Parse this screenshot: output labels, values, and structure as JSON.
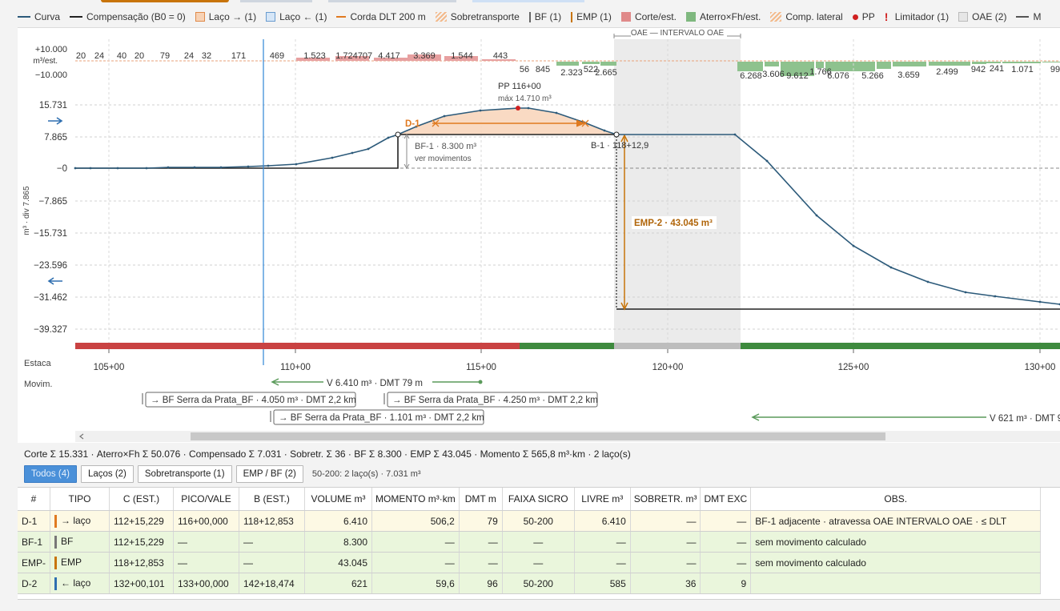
{
  "legend": [
    {
      "type": "line",
      "color": "#2c5a7a",
      "label": "Curva"
    },
    {
      "type": "line",
      "color": "#222222",
      "label": "Compensação (B0 = 0)"
    },
    {
      "type": "box",
      "fill": "#f7d2b5",
      "border": "#e08a4a",
      "label": "Laço → (1)"
    },
    {
      "type": "box",
      "fill": "#d6e6f7",
      "border": "#6a9ccf",
      "label": "Laço ← (1)"
    },
    {
      "type": "dash",
      "color": "#e07a20",
      "label": "Corda DLT 200 m"
    },
    {
      "type": "hatch",
      "label": "Sobretransporte"
    },
    {
      "type": "vbar",
      "color": "#666666",
      "label": "BF (1)"
    },
    {
      "type": "vbar",
      "color": "#c8740a",
      "label": "EMP (1)"
    },
    {
      "type": "box",
      "fill": "#e08a8a",
      "border": "#e08a8a",
      "label": "Corte/est."
    },
    {
      "type": "box",
      "fill": "#7fb87f",
      "border": "#7fb87f",
      "label": "Aterro×Fh/est."
    },
    {
      "type": "hatch",
      "label": "Comp. lateral"
    },
    {
      "type": "dot",
      "color": "#d02020",
      "label": "PP"
    },
    {
      "type": "excl",
      "label": "Limitador (1)"
    },
    {
      "type": "box",
      "fill": "#e6e6e6",
      "border": "#bbbbbb",
      "label": "OAE (2)"
    },
    {
      "type": "line",
      "color": "#555555",
      "label": "M"
    }
  ],
  "plot": {
    "vol_axis_label": "m³/est.",
    "vol_ticks": [
      "+10.000",
      "−10.000"
    ],
    "y_axis_label": "m³ · div 7.865",
    "y_ticks": [
      "15.731",
      "7.865",
      "−0",
      "−7.865",
      "−15.731",
      "−23.596",
      "−31.462",
      "−39.327"
    ],
    "x_row_label": "Estaca",
    "x_ticks": [
      "105+00",
      "110+00",
      "115+00",
      "120+00",
      "125+00",
      "130+00"
    ],
    "movim_label": "Movim.",
    "oae_label": "OAE — INTERVALO OAE",
    "cut_labels": [
      "20",
      "24",
      "40",
      "20",
      "79",
      "24",
      "32",
      "171",
      "469",
      "1.523",
      "1.724",
      "707",
      "4.417",
      "3.369",
      "1.544",
      "443"
    ],
    "fill_labels_top": [
      "56",
      "845"
    ],
    "fill_labels": [
      "2.323",
      "522",
      "2.665",
      "6.268",
      "3.606",
      "9.612",
      "1.766",
      "6.076",
      "5.266",
      "3.659",
      "2.499",
      "942",
      "241",
      "1.071",
      "99"
    ],
    "pp_label": "PP 116+00",
    "pp_sub": "máx 14.710 m³",
    "d1_label": "D-1",
    "bf_label": "BF-1 · 8.300 m³",
    "bf_sub": "ver movimentos",
    "b1_label": "B-1 · 118+12,9",
    "emp_label": "EMP-2 · 43.045 m³",
    "move_v1": "V 6.410 m³ · DMT 79 m",
    "move_bf1": "→ BF Serra da Prata_BF · 4.050 m³ · DMT 2,2 km",
    "move_bf2": "→ BF Serra da Prata_BF · 4.250 m³ · DMT 2,2 km",
    "move_bf3": "→ BF Serra da Prata_BF · 1.101 m³ · DMT 2,2 km",
    "move_v2": "V 621 m³ · DMT 9"
  },
  "summary": "Corte Σ 15.331 · Aterro×Fh Σ 50.076 · Compensado Σ 7.031 · Sobretr. Σ 36 · BF Σ 8.300 · EMP Σ 43.045 · Momento Σ 565,8 m³·km · 2 laço(s)",
  "filters": {
    "buttons": [
      "Todos (4)",
      "Laços (2)",
      "Sobretransporte (1)",
      "EMP / BF (2)"
    ],
    "note": "50-200: 2 laço(s) · 7.031 m³"
  },
  "table": {
    "headers": [
      "#",
      "TIPO",
      "C (EST.)",
      "PICO/VALE",
      "B (EST.)",
      "VOLUME m³",
      "MOMENTO m³·km",
      "DMT m",
      "FAIXA SICRO",
      "LIVRE m³",
      "SOBRETR. m³",
      "DMT EXC",
      "OBS."
    ],
    "rows": [
      {
        "tag": "#e07a20",
        "cells": [
          "D-1",
          "→ laço",
          "112+15,229",
          "116+00,000",
          "118+12,853",
          "6.410",
          "506,2",
          "79",
          "50-200",
          "6.410",
          "—",
          "—",
          "BF-1 adjacente · atravessa OAE INTERVALO OAE · ≤ DLT"
        ]
      },
      {
        "tag": "#777777",
        "cells": [
          "BF-1",
          "BF",
          "112+15,229",
          "—",
          "—",
          "8.300",
          "—",
          "—",
          "—",
          "—",
          "—",
          "—",
          "sem movimento calculado"
        ]
      },
      {
        "tag": "#c8740a",
        "cells": [
          "EMP-",
          "EMP",
          "118+12,853",
          "—",
          "—",
          "43.045",
          "—",
          "—",
          "—",
          "—",
          "—",
          "—",
          "sem movimento calculado"
        ]
      },
      {
        "tag": "#2f6fb0",
        "cells": [
          "D-2",
          "← laço",
          "132+00,101",
          "133+00,000",
          "142+18,474",
          "621",
          "59,6",
          "96",
          "50-200",
          "585",
          "36",
          "9",
          ""
        ]
      }
    ]
  }
}
